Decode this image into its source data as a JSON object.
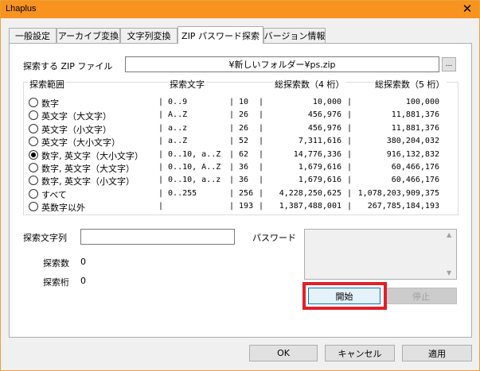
{
  "window": {
    "title": "Lhaplus",
    "close_icon": "close-icon"
  },
  "tabs": [
    {
      "label": "一般設定"
    },
    {
      "label": "アーカイブ変換"
    },
    {
      "label": "文字列変換"
    },
    {
      "label": "ZIP パスワード探索"
    },
    {
      "label": "バージョン情報"
    }
  ],
  "form": {
    "file_label": "探索する ZIP ファイル",
    "file_value": "¥新しいフォルダー¥ps.zip",
    "browse_label": "...",
    "range_header": "探索範囲",
    "chars_header": "探索文字",
    "total4_header": "総探索数（4 桁）",
    "total5_header": "総探索数（5 桁）",
    "rows": [
      {
        "label": "数字",
        "chars": "| 0..9",
        "count": "| 10",
        "t4": "10,000",
        "t5": "100,000",
        "selected": false
      },
      {
        "label": "英文字（大文字）",
        "chars": "| A..Z",
        "count": "| 26",
        "t4": "456,976",
        "t5": "11,881,376",
        "selected": false
      },
      {
        "label": "英文字（小文字）",
        "chars": "| a..z",
        "count": "| 26",
        "t4": "456,976",
        "t5": "11,881,376",
        "selected": false
      },
      {
        "label": "英文字（大小文字）",
        "chars": "| a..Z",
        "count": "| 52",
        "t4": "7,311,616",
        "t5": "380,204,032",
        "selected": false
      },
      {
        "label": "数字, 英文字（大小文字）",
        "chars": "| 0..10, a..Z",
        "count": "| 62",
        "t4": "14,776,336",
        "t5": "916,132,832",
        "selected": true
      },
      {
        "label": "数字, 英文字（大文字）",
        "chars": "| 0..10, A..Z",
        "count": "| 36",
        "t4": "1,679,616",
        "t5": "60,466,176",
        "selected": false
      },
      {
        "label": "数字, 英文字（小文字）",
        "chars": "| 0..10, a..z",
        "count": "| 36",
        "t4": "1,679,616",
        "t5": "60,466,176",
        "selected": false
      },
      {
        "label": "すべて",
        "chars": "| 0..255",
        "count": "| 256",
        "t4": "4,228,250,625",
        "t5": "1,078,203,909,375",
        "selected": false
      },
      {
        "label": "英数字以外",
        "chars": "|",
        "count": "| 193",
        "t4": "1,387,488,001",
        "t5": "267,785,184,193",
        "selected": false
      }
    ],
    "search_string_label": "探索文字列",
    "search_string_value": "",
    "password_label": "パスワード",
    "search_count_label": "探索数",
    "search_count_value": "0",
    "search_digits_label": "探索桁",
    "search_digits_value": "0",
    "start_label": "開始",
    "stop_label": "停止"
  },
  "footer": {
    "ok_label": "OK",
    "cancel_label": "キャンセル",
    "apply_label": "適用"
  }
}
